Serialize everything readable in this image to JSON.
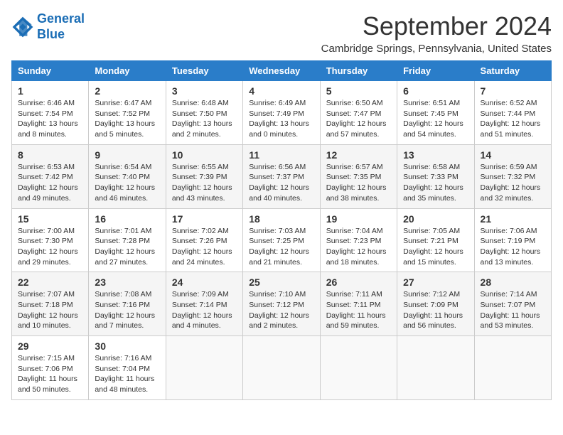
{
  "header": {
    "logo_line1": "General",
    "logo_line2": "Blue",
    "month_title": "September 2024",
    "location": "Cambridge Springs, Pennsylvania, United States"
  },
  "days_of_week": [
    "Sunday",
    "Monday",
    "Tuesday",
    "Wednesday",
    "Thursday",
    "Friday",
    "Saturday"
  ],
  "weeks": [
    [
      {
        "day": "1",
        "info": "Sunrise: 6:46 AM\nSunset: 7:54 PM\nDaylight: 13 hours\nand 8 minutes."
      },
      {
        "day": "2",
        "info": "Sunrise: 6:47 AM\nSunset: 7:52 PM\nDaylight: 13 hours\nand 5 minutes."
      },
      {
        "day": "3",
        "info": "Sunrise: 6:48 AM\nSunset: 7:50 PM\nDaylight: 13 hours\nand 2 minutes."
      },
      {
        "day": "4",
        "info": "Sunrise: 6:49 AM\nSunset: 7:49 PM\nDaylight: 13 hours\nand 0 minutes."
      },
      {
        "day": "5",
        "info": "Sunrise: 6:50 AM\nSunset: 7:47 PM\nDaylight: 12 hours\nand 57 minutes."
      },
      {
        "day": "6",
        "info": "Sunrise: 6:51 AM\nSunset: 7:45 PM\nDaylight: 12 hours\nand 54 minutes."
      },
      {
        "day": "7",
        "info": "Sunrise: 6:52 AM\nSunset: 7:44 PM\nDaylight: 12 hours\nand 51 minutes."
      }
    ],
    [
      {
        "day": "8",
        "info": "Sunrise: 6:53 AM\nSunset: 7:42 PM\nDaylight: 12 hours\nand 49 minutes."
      },
      {
        "day": "9",
        "info": "Sunrise: 6:54 AM\nSunset: 7:40 PM\nDaylight: 12 hours\nand 46 minutes."
      },
      {
        "day": "10",
        "info": "Sunrise: 6:55 AM\nSunset: 7:39 PM\nDaylight: 12 hours\nand 43 minutes."
      },
      {
        "day": "11",
        "info": "Sunrise: 6:56 AM\nSunset: 7:37 PM\nDaylight: 12 hours\nand 40 minutes."
      },
      {
        "day": "12",
        "info": "Sunrise: 6:57 AM\nSunset: 7:35 PM\nDaylight: 12 hours\nand 38 minutes."
      },
      {
        "day": "13",
        "info": "Sunrise: 6:58 AM\nSunset: 7:33 PM\nDaylight: 12 hours\nand 35 minutes."
      },
      {
        "day": "14",
        "info": "Sunrise: 6:59 AM\nSunset: 7:32 PM\nDaylight: 12 hours\nand 32 minutes."
      }
    ],
    [
      {
        "day": "15",
        "info": "Sunrise: 7:00 AM\nSunset: 7:30 PM\nDaylight: 12 hours\nand 29 minutes."
      },
      {
        "day": "16",
        "info": "Sunrise: 7:01 AM\nSunset: 7:28 PM\nDaylight: 12 hours\nand 27 minutes."
      },
      {
        "day": "17",
        "info": "Sunrise: 7:02 AM\nSunset: 7:26 PM\nDaylight: 12 hours\nand 24 minutes."
      },
      {
        "day": "18",
        "info": "Sunrise: 7:03 AM\nSunset: 7:25 PM\nDaylight: 12 hours\nand 21 minutes."
      },
      {
        "day": "19",
        "info": "Sunrise: 7:04 AM\nSunset: 7:23 PM\nDaylight: 12 hours\nand 18 minutes."
      },
      {
        "day": "20",
        "info": "Sunrise: 7:05 AM\nSunset: 7:21 PM\nDaylight: 12 hours\nand 15 minutes."
      },
      {
        "day": "21",
        "info": "Sunrise: 7:06 AM\nSunset: 7:19 PM\nDaylight: 12 hours\nand 13 minutes."
      }
    ],
    [
      {
        "day": "22",
        "info": "Sunrise: 7:07 AM\nSunset: 7:18 PM\nDaylight: 12 hours\nand 10 minutes."
      },
      {
        "day": "23",
        "info": "Sunrise: 7:08 AM\nSunset: 7:16 PM\nDaylight: 12 hours\nand 7 minutes."
      },
      {
        "day": "24",
        "info": "Sunrise: 7:09 AM\nSunset: 7:14 PM\nDaylight: 12 hours\nand 4 minutes."
      },
      {
        "day": "25",
        "info": "Sunrise: 7:10 AM\nSunset: 7:12 PM\nDaylight: 12 hours\nand 2 minutes."
      },
      {
        "day": "26",
        "info": "Sunrise: 7:11 AM\nSunset: 7:11 PM\nDaylight: 11 hours\nand 59 minutes."
      },
      {
        "day": "27",
        "info": "Sunrise: 7:12 AM\nSunset: 7:09 PM\nDaylight: 11 hours\nand 56 minutes."
      },
      {
        "day": "28",
        "info": "Sunrise: 7:14 AM\nSunset: 7:07 PM\nDaylight: 11 hours\nand 53 minutes."
      }
    ],
    [
      {
        "day": "29",
        "info": "Sunrise: 7:15 AM\nSunset: 7:06 PM\nDaylight: 11 hours\nand 50 minutes."
      },
      {
        "day": "30",
        "info": "Sunrise: 7:16 AM\nSunset: 7:04 PM\nDaylight: 11 hours\nand 48 minutes."
      },
      {
        "day": "",
        "info": ""
      },
      {
        "day": "",
        "info": ""
      },
      {
        "day": "",
        "info": ""
      },
      {
        "day": "",
        "info": ""
      },
      {
        "day": "",
        "info": ""
      }
    ]
  ]
}
